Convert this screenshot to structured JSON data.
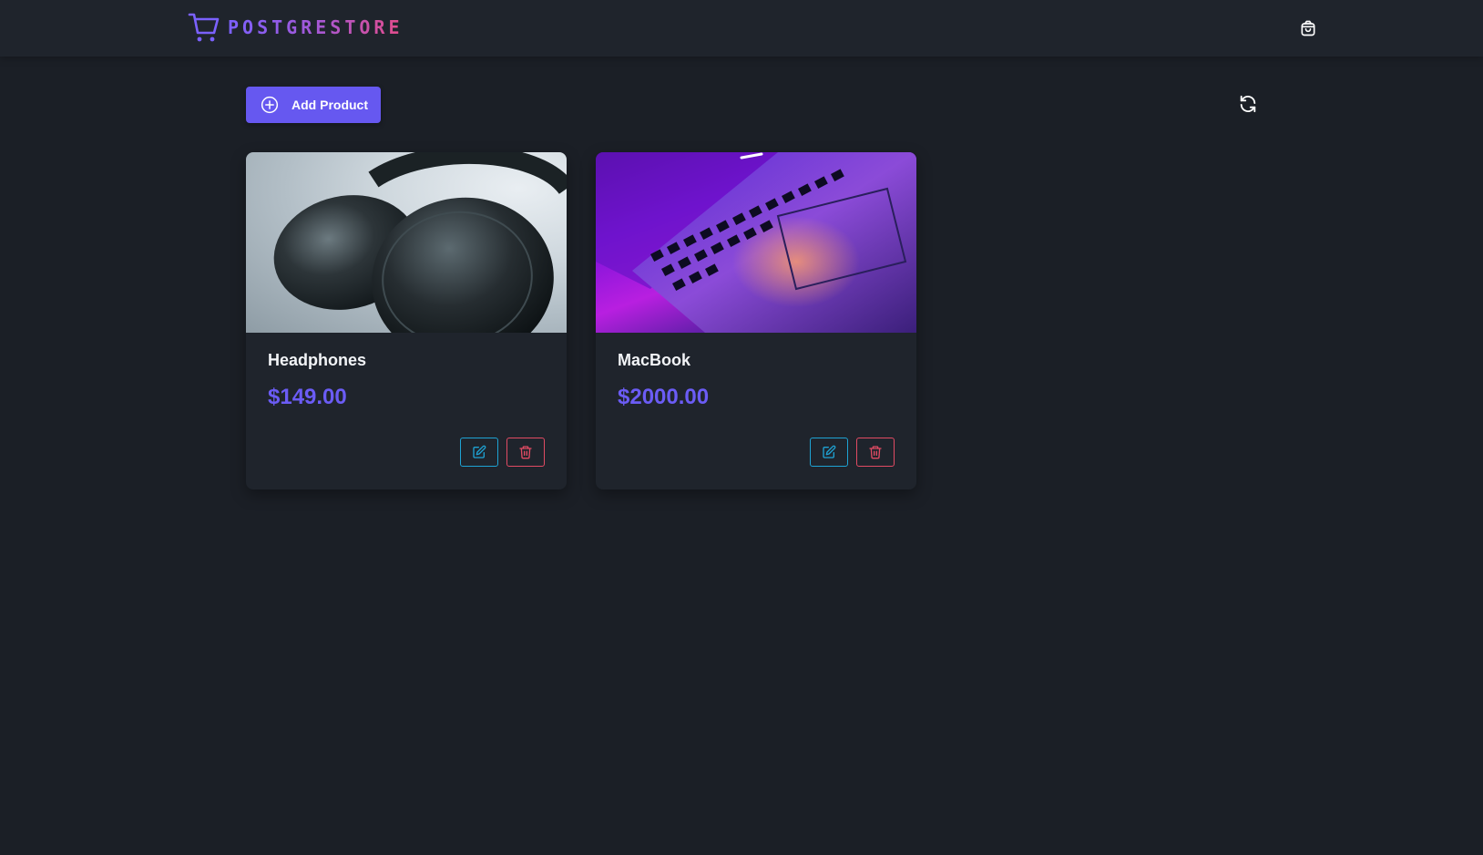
{
  "header": {
    "brand_name": "POSTGRESTORE",
    "brand_icon": "shopping-cart-icon",
    "cart_icon": "shopping-bag-icon"
  },
  "toolbar": {
    "add_label": "Add Product",
    "add_icon": "plus-circle-icon",
    "refresh_icon": "refresh-icon"
  },
  "products": [
    {
      "name": "Headphones",
      "price": "$149.00",
      "image": "headphones photo",
      "edit_icon": "edit-icon",
      "delete_icon": "trash-icon"
    },
    {
      "name": "MacBook",
      "price": "$2000.00",
      "image": "macbook photo",
      "edit_icon": "edit-icon",
      "delete_icon": "trash-icon"
    }
  ],
  "colors": {
    "background": "#1b1f26",
    "surface": "#1f242c",
    "primary": "#6658f0",
    "price": "#6b5cf5",
    "edit": "#1ea3d4",
    "delete": "#e14b63"
  }
}
